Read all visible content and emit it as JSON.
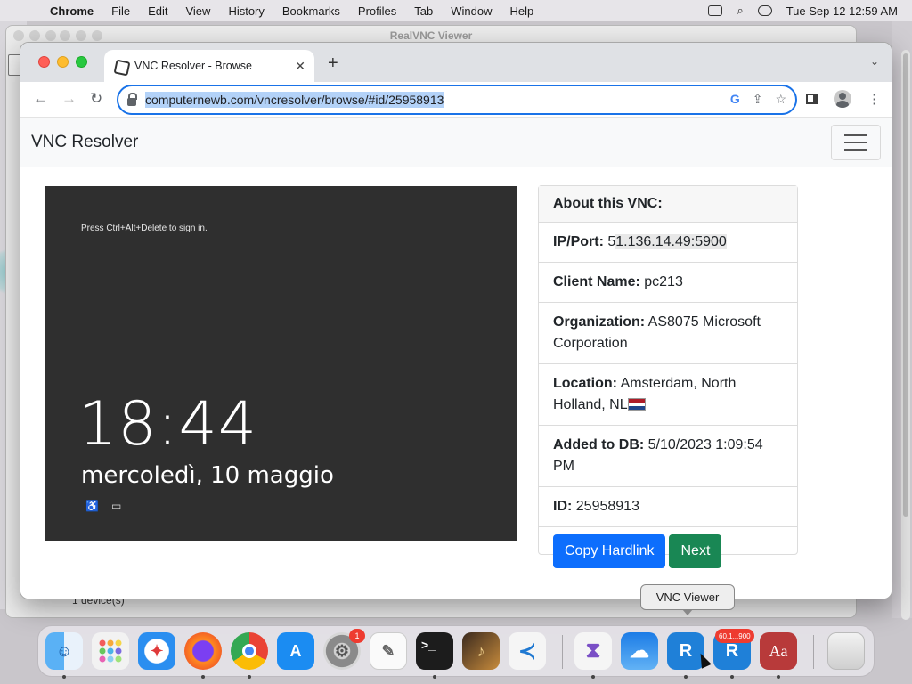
{
  "menubar": {
    "app": "Chrome",
    "items": [
      "File",
      "Edit",
      "View",
      "History",
      "Bookmarks",
      "Profiles",
      "Tab",
      "Window",
      "Help"
    ],
    "clock": "Tue Sep 12  12:59 AM"
  },
  "bg_window": {
    "title": "RealVNC Viewer",
    "footer": "1 device(s)"
  },
  "chrome": {
    "tab_title": "VNC Resolver - Browse",
    "url": "computernewb.com/vncresolver/browse/#id/25958913",
    "new_tab_symbol": "+",
    "close_symbol": "✕"
  },
  "page": {
    "brand": "VNC Resolver",
    "screenshot": {
      "hint": "Press Ctrl+Alt+Delete to sign in.",
      "time": "18:44",
      "date": "mercoledì, 10 maggio"
    },
    "card": {
      "header": "About this VNC:",
      "ip_label": "IP/Port:",
      "ip_value_prefix": "5",
      "ip_value_highlight": "1.136.14.49:5900",
      "client_label": "Client Name:",
      "client_value": "pc213",
      "org_label": "Organization:",
      "org_value": "AS8075 Microsoft Corporation",
      "loc_label": "Location:",
      "loc_value": "Amsterdam, North Holland, NL",
      "added_label": "Added to DB:",
      "added_value": "5/10/2023 1:09:54 PM",
      "id_label": "ID:",
      "id_value": "25958913",
      "copy_button": "Copy Hardlink",
      "next_button": "Next"
    }
  },
  "tooltip": "VNC Viewer",
  "dock": {
    "settings_badge": "1",
    "rvnc_badge": "60.1...900",
    "dictionary_label": "Aa"
  },
  "colors": {
    "primary": "#0d6efd",
    "success": "#198754",
    "omnibox_focus": "#1a73e8"
  }
}
